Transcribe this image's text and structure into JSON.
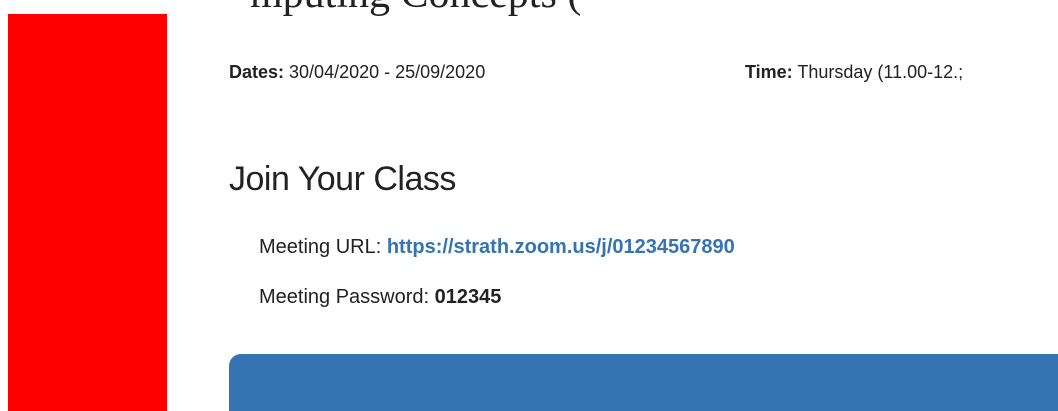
{
  "colors": {
    "left_bar": "#ff0000",
    "link": "#3573b3",
    "panel": "#3573b3"
  },
  "header": {
    "partial_title": "mputing Concepts ("
  },
  "meta": {
    "dates_label": "Dates:",
    "dates_value": " 30/04/2020 - 25/09/2020",
    "time_label": "Time:",
    "time_value": " Thursday (11.00-12.;"
  },
  "section": {
    "title": "Join Your Class"
  },
  "meeting": {
    "url_label": "Meeting URL: ",
    "url_value": "https://strath.zoom.us/j/01234567890",
    "password_label": "Meeting Password: ",
    "password_value": "012345"
  }
}
